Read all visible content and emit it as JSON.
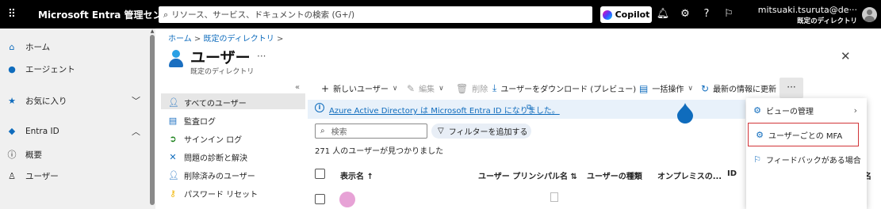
{
  "topbar": {
    "waffle": "⠿",
    "brand": "Microsoft Entra 管理センター",
    "search_placeholder": "リソース、サービス、ドキュメントの検索 (G+/)",
    "copilot_label": "Copilot",
    "user_name": "mitsuaki.tsuruta@de···",
    "user_directory": "既定のディレクトリ"
  },
  "leftnav": {
    "items": [
      {
        "label": "ホーム",
        "icon": "home-icon"
      },
      {
        "label": "エージェント",
        "icon": "agent-icon"
      },
      {
        "label": "お気に入り",
        "icon": "star-icon"
      },
      {
        "label": "Entra ID",
        "icon": "diamond-icon"
      },
      {
        "label": "概要",
        "icon": "info-icon"
      },
      {
        "label": "ユーザー",
        "icon": "person-icon"
      }
    ]
  },
  "breadcrumb": {
    "home": "ホーム",
    "sep": " > ",
    "dir": "既定のディレクトリ",
    "end": " >"
  },
  "page": {
    "title": "ユーザー",
    "more": "···",
    "subtitle": "既定のディレクトリ"
  },
  "subnav": {
    "items": [
      {
        "label": "すべてのユーザー"
      },
      {
        "label": "監査ログ"
      },
      {
        "label": "サインイン ログ"
      },
      {
        "label": "問題の診断と解決"
      },
      {
        "label": "削除済みのユーザー"
      },
      {
        "label": "パスワード リセット"
      }
    ]
  },
  "toolbar": {
    "new_user": "新しいユーザー",
    "edit": "編集",
    "delete": "削除",
    "download": "ユーザーをダウンロード (プレビュー)",
    "bulk": "一括操作",
    "refresh": "最新の情報に更新",
    "more": "···"
  },
  "banner": {
    "text": "Azure Active Directory は Microsoft Entra ID になりました。"
  },
  "list": {
    "search_placeholder": "検索",
    "filter_label": "フィルターを追加する",
    "count_text": "271 人のユーザーが見つかりました"
  },
  "table": {
    "headers": [
      "表示名 ↑",
      "ユーザー プリンシパル名 ⇅",
      "ユーザーの種類",
      "オンプレミスの...",
      "ID",
      "会社名"
    ]
  },
  "menu": {
    "items": [
      {
        "label": "ビューの管理",
        "icon": "gear-icon",
        "has_sub": true
      },
      {
        "label": "ユーザーごとの MFA",
        "icon": "gear-icon",
        "highlighted": true
      },
      {
        "label": "フィードバックがある場合",
        "icon": "feedback-icon"
      }
    ]
  },
  "colors": {
    "accent": "#0f6cbd",
    "highlight": "#d13438"
  }
}
